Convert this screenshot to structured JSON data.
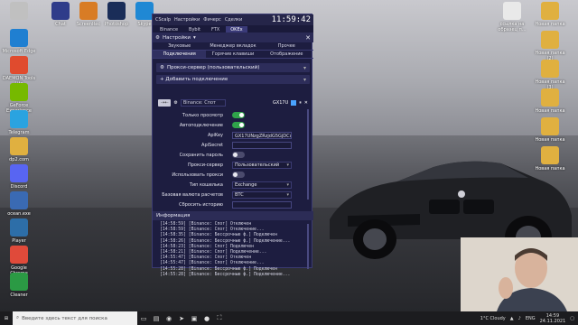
{
  "desktop": {
    "icons_left": [
      {
        "label": "",
        "color": "#c0c0c0"
      },
      {
        "label": "Microsoft Edge",
        "color": "#1f7fd1"
      },
      {
        "label": "DAEMON Tools Lite",
        "color": "#e04b2e"
      },
      {
        "label": "GeForce Experience",
        "color": "#76b900"
      },
      {
        "label": "Telegram",
        "color": "#2aa3e0"
      },
      {
        "label": "dp2.com",
        "color": "#e0b040"
      },
      {
        "label": "Discord",
        "color": "#5865f2"
      },
      {
        "label": "ocean.exe",
        "color": "#3a6ab3"
      },
      {
        "label": "Player",
        "color": "#2d6ea8"
      },
      {
        "label": "Google Chrome",
        "color": "#e04a3a"
      },
      {
        "label": "Cleaner",
        "color": "#2b9a44"
      }
    ],
    "icons_top": [
      {
        "label": "Chat",
        "color": "#2f3c8a"
      },
      {
        "label": "ScreenRec",
        "color": "#d87c25"
      },
      {
        "label": "Photoshop",
        "color": "#1a2d58"
      },
      {
        "label": "Skype",
        "color": "#1f88d4"
      }
    ],
    "icons_right": [
      {
        "label": "ссылка на образец п...",
        "color": "#e9e9e9"
      },
      {
        "label": "Новая папка",
        "color": "#e0b040"
      },
      {
        "label": "Новая папка (2)",
        "color": "#e0b040"
      },
      {
        "label": "Новая папка (3)",
        "color": "#e0b040"
      },
      {
        "label": "Новая папка",
        "color": "#e0b040"
      },
      {
        "label": "Новая папка",
        "color": "#e0b040"
      },
      {
        "label": "Новая папка",
        "color": "#e0b040"
      }
    ]
  },
  "app": {
    "title": "CScalp",
    "menu": [
      "Настройки",
      "Фичерс",
      "Сделки"
    ],
    "clock": "11:59:42",
    "exchanges": [
      "Binance",
      "Bybit",
      "FTX",
      "OKEx"
    ],
    "active_exchange": "OKEx",
    "settings": {
      "title": "Настройки",
      "close": "✕",
      "tabs_row1": [
        "Звуковые уведомления",
        "Менеджер вкладок",
        "Прочее"
      ],
      "tabs_row2": [
        "Подключения",
        "Горячие клавиши",
        "Отображение"
      ],
      "active_tab": "Подключения",
      "proxy_section": "Прокси-сервер (пользовательский)",
      "add_connection": "+ Добавить подключение",
      "connection": {
        "exchange": "Binance: Спот",
        "id": "GX17U"
      },
      "fields": [
        {
          "label": "Только просмотр",
          "type": "toggle",
          "value": true
        },
        {
          "label": "Автоподключение",
          "type": "toggle",
          "value": true
        },
        {
          "label": "ApiKey",
          "type": "text",
          "value": "GX17UNzgZRzjdG5GjDCu7"
        },
        {
          "label": "ApiSecret",
          "type": "text",
          "value": ""
        },
        {
          "label": "Сохранить пароль",
          "type": "toggle",
          "value": false
        },
        {
          "label": "Прокси-сервер",
          "type": "select",
          "value": "Пользовательский"
        },
        {
          "label": "Использовать прокси",
          "type": "toggle",
          "value": false
        },
        {
          "label": "Тип кошелька",
          "type": "select",
          "value": "Exchange"
        },
        {
          "label": "Базовая валюта расчетов",
          "type": "select",
          "value": "BTC"
        },
        {
          "label": "Сбросить историю",
          "type": "text",
          "value": ""
        }
      ]
    },
    "info": {
      "title": "Информация",
      "log": [
        "[14:58:59] [Binance: Спот] Отключен",
        "[14:58:59] [Binance: Спот] Отключение...",
        "[14:58:35] [Binance: Бессрочные ф.] Подключен",
        "[14:58:26] [Binance: Бессрочные ф.] Подключение...",
        "[14:58:23] [Binance: Спот] Подключен",
        "[14:58:21] [Binance: Спот] Подключение...",
        "[14:55:47] [Binance: Спот] Отключен",
        "[14:55:47] [Binance: Спот] Отключение...",
        "[14:55:28] [Binance: Бессрочные ф.] Подключен",
        "[14:55:28] [Binance: Бессрочные ф.] Подключение..."
      ]
    }
  },
  "taskbar": {
    "search_placeholder": "Введите здесь текст для поиска",
    "weather": "1°C Cloudy",
    "lang": "ENG",
    "time": "14:59",
    "date": "24.11.2021"
  }
}
